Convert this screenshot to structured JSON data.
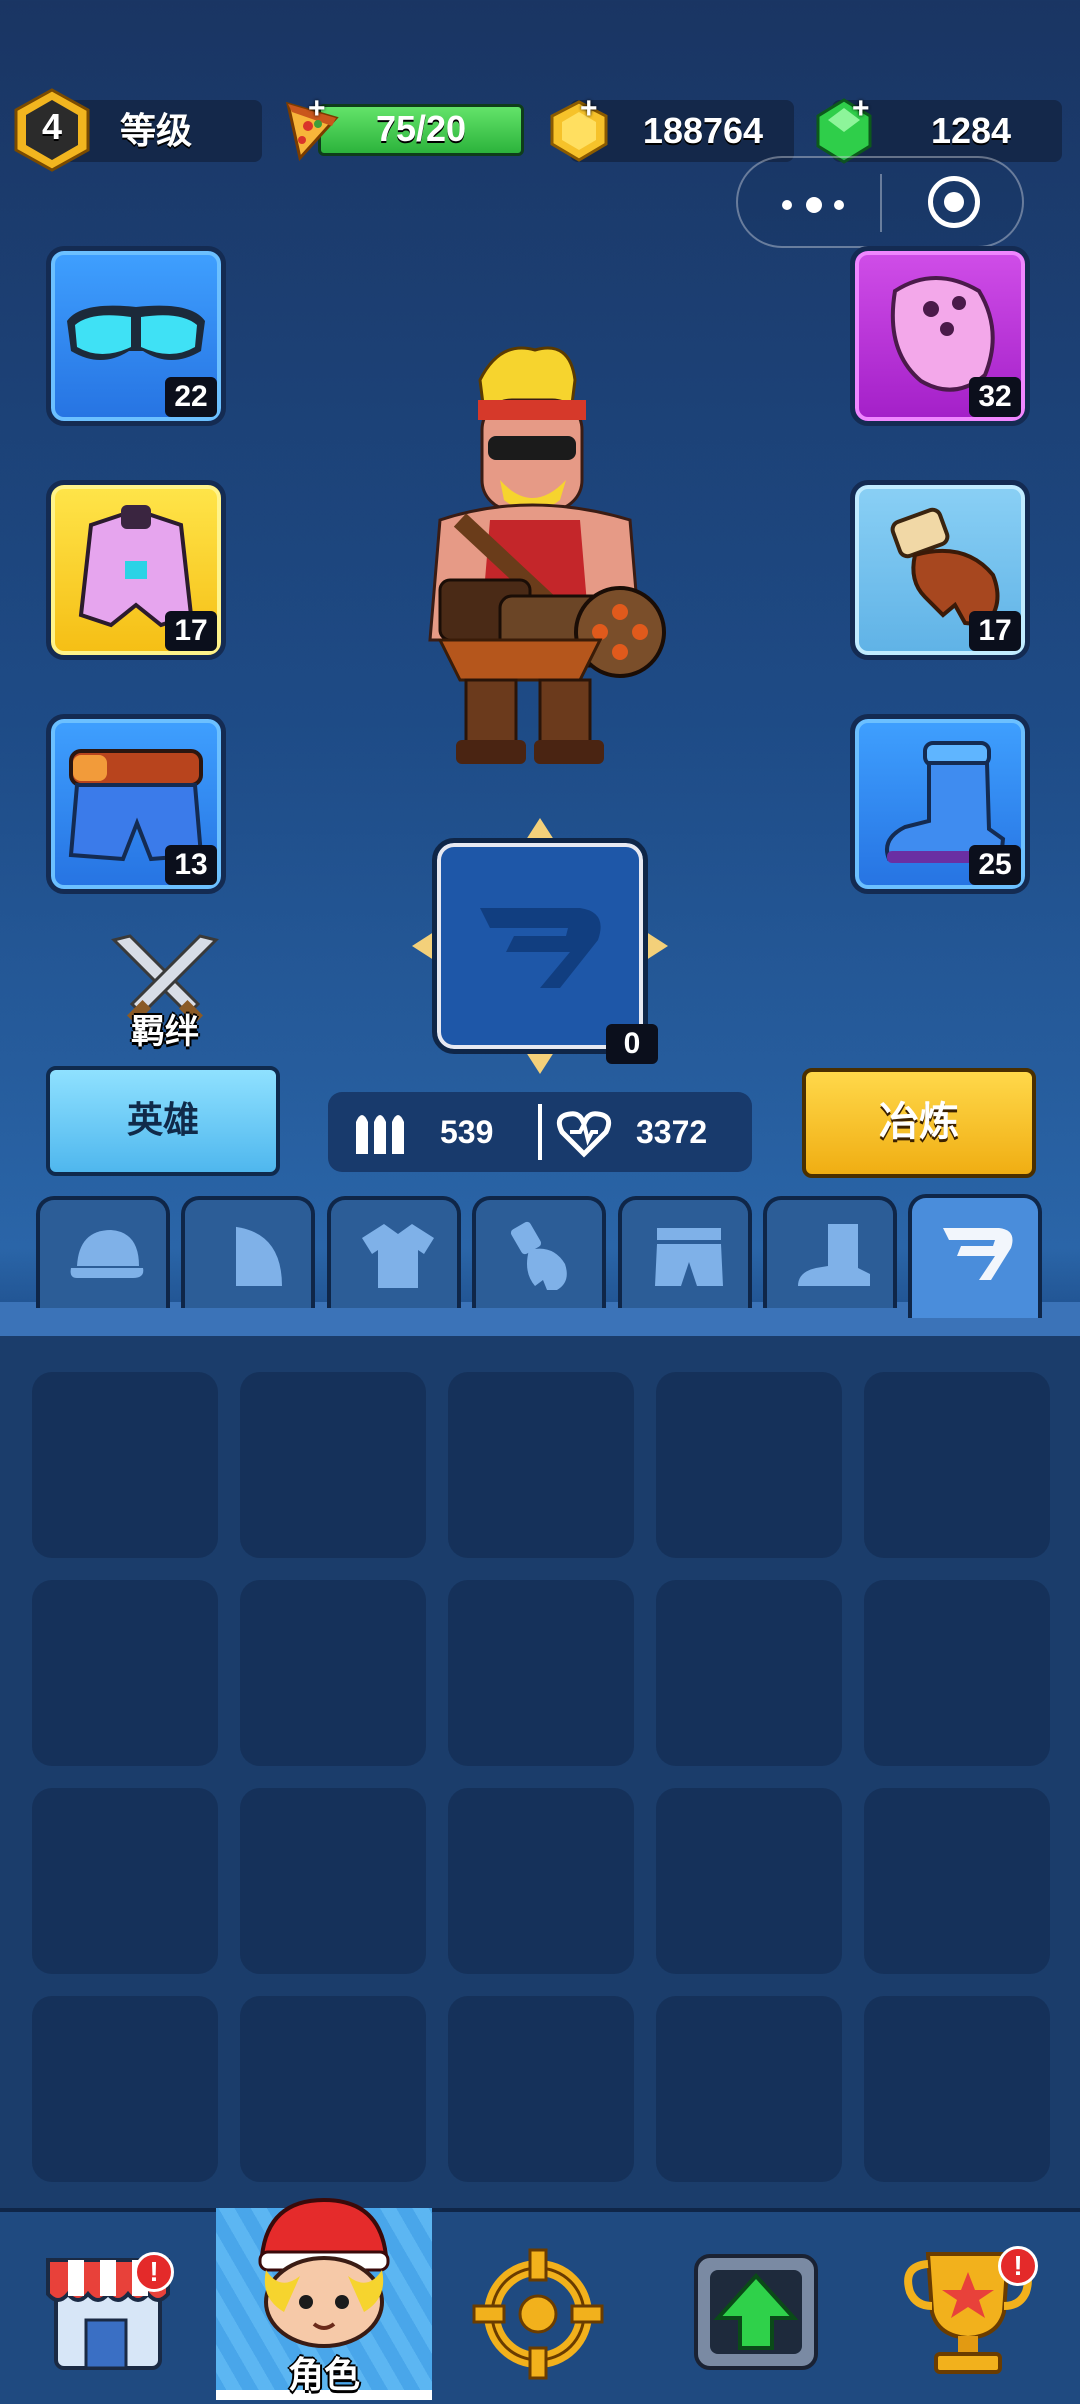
{
  "hud": {
    "level_number": "4",
    "level_label": "等级",
    "energy": "75/20",
    "gold": "188764",
    "gems": "1284"
  },
  "equipment": {
    "left": [
      {
        "name": "goggles",
        "level": "22"
      },
      {
        "name": "vest",
        "level": "17"
      },
      {
        "name": "shorts",
        "level": "13"
      }
    ],
    "right": [
      {
        "name": "shoulder-pad",
        "level": "32"
      },
      {
        "name": "glove",
        "level": "17"
      },
      {
        "name": "boot",
        "level": "25"
      }
    ],
    "center_wing_level": "0"
  },
  "bond_label": "羁绊",
  "buttons": {
    "hero": "英雄",
    "smelt": "冶炼"
  },
  "stats": {
    "attack": "539",
    "health": "3372"
  },
  "tabs": [
    "hat-icon",
    "shoulder-icon",
    "shirt-icon",
    "glove-icon",
    "shorts-icon",
    "boot-icon",
    "wing-icon"
  ],
  "active_tab": 6,
  "bottom_nav": {
    "active_label": "角色"
  },
  "colors": {
    "smelt": "#f0ae13",
    "hero": "#4fb7ee",
    "energy": "#2cb33c"
  }
}
